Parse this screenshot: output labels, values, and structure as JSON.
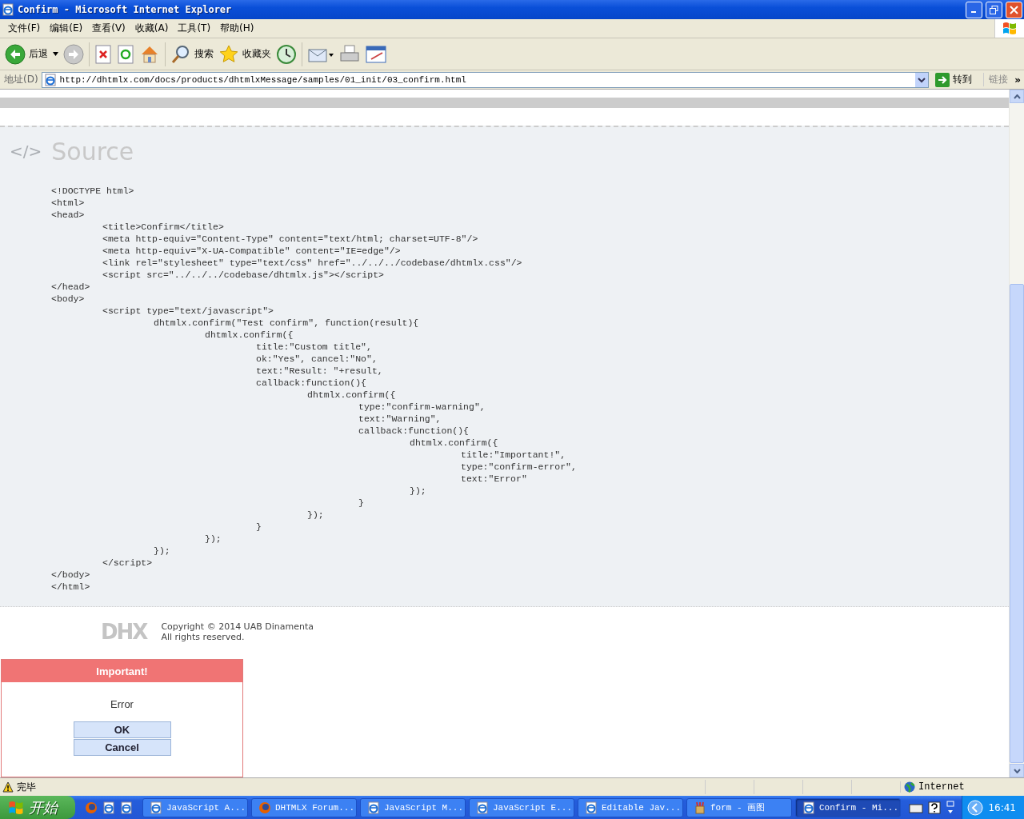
{
  "window": {
    "title": "Confirm - Microsoft Internet Explorer"
  },
  "menu": [
    "文件(F)",
    "编辑(E)",
    "查看(V)",
    "收藏(A)",
    "工具(T)",
    "帮助(H)"
  ],
  "toolbar": {
    "back": "后退",
    "search": "搜索",
    "favorites": "收藏夹"
  },
  "address_bar": {
    "label": "地址(D)",
    "value": "http://dhtmlx.com/docs/products/dhtmlxMessage/samples/01_init/03_confirm.html",
    "go": "转到",
    "links": "链接",
    "more": "»"
  },
  "source": {
    "icon_text": "</>",
    "heading": "Source",
    "code": [
      "<!DOCTYPE html>",
      "<html>",
      "<head>",
      "\t<title>Confirm</title>",
      "\t<meta http-equiv=\"Content-Type\" content=\"text/html; charset=UTF-8\"/>",
      "\t<meta http-equiv=\"X-UA-Compatible\" content=\"IE=edge\"/>",
      "\t<link rel=\"stylesheet\" type=\"text/css\" href=\"../../../codebase/dhtmlx.css\"/>",
      "\t<script src=\"../../../codebase/dhtmlx.js\"></script>",
      "</head>",
      "<body>",
      "\t<script type=\"text/javascript\">",
      "\t\tdhtmlx.confirm(\"Test confirm\", function(result){",
      "\t\t\tdhtmlx.confirm({",
      "\t\t\t\ttitle:\"Custom title\",",
      "\t\t\t\tok:\"Yes\", cancel:\"No\",",
      "\t\t\t\ttext:\"Result: \"+result,",
      "\t\t\t\tcallback:function(){",
      "\t\t\t\t\tdhtmlx.confirm({",
      "\t\t\t\t\t\ttype:\"confirm-warning\",",
      "\t\t\t\t\t\ttext:\"Warning\",",
      "\t\t\t\t\t\tcallback:function(){",
      "\t\t\t\t\t\t\tdhtmlx.confirm({",
      "\t\t\t\t\t\t\t\ttitle:\"Important!\",",
      "\t\t\t\t\t\t\t\ttype:\"confirm-error\",",
      "\t\t\t\t\t\t\t\ttext:\"Error\"",
      "\t\t\t\t\t\t\t});",
      "\t\t\t\t\t\t}",
      "\t\t\t\t\t});",
      "\t\t\t\t}",
      "\t\t\t});",
      "\t\t});",
      "\t</script>",
      "</body>",
      "</html>"
    ]
  },
  "footer": {
    "logo": "DHX",
    "copyright": "Copyright © 2014 UAB Dinamenta",
    "rights": "All rights reserved."
  },
  "dialog": {
    "title": "Important!",
    "text": "Error",
    "buttons": [
      "OK",
      "Cancel"
    ]
  },
  "status_bar": {
    "text": "完毕",
    "zone": "Internet"
  },
  "taskbar": {
    "start": "开始",
    "clock": "16:41",
    "tasks": [
      {
        "label": "JavaScript A...",
        "kind": "ie",
        "selected": false
      },
      {
        "label": "DHTMLX Forum...",
        "kind": "firefox",
        "selected": false
      },
      {
        "label": "JavaScript M...",
        "kind": "ie",
        "selected": false
      },
      {
        "label": "JavaScript E...",
        "kind": "ie",
        "selected": false
      },
      {
        "label": "Editable Jav...",
        "kind": "ie",
        "selected": false
      },
      {
        "label": "form - 画图",
        "kind": "paint",
        "selected": false
      },
      {
        "label": "Confirm - Mi...",
        "kind": "ie",
        "selected": true
      }
    ]
  }
}
